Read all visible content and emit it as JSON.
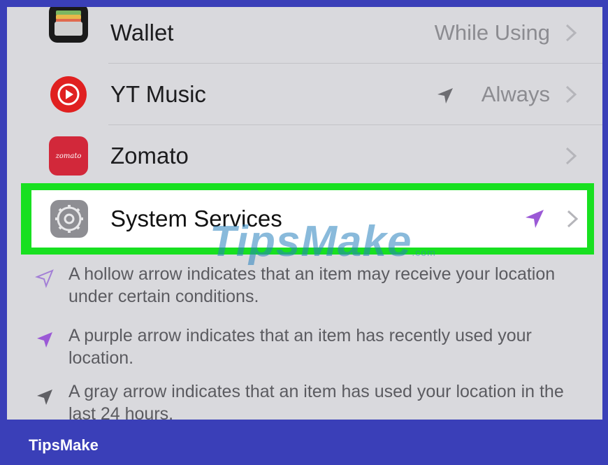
{
  "apps": [
    {
      "name": "Wallet",
      "value": "While Using",
      "icon": "wallet-icon"
    },
    {
      "name": "YT Music",
      "value": "Always",
      "icon": "yt-music-icon",
      "status_icon": "location-arrow-gray-icon"
    },
    {
      "name": "Zomato",
      "value": "",
      "icon": "zomato-icon",
      "icon_text": "zomato"
    }
  ],
  "highlighted": {
    "name": "System Services",
    "icon": "settings-gear-icon",
    "status_icon": "location-arrow-purple-icon",
    "frame_color": "#18e020"
  },
  "legend": [
    {
      "icon": "hollow-arrow-icon",
      "text": "A hollow arrow indicates that an item may receive your location under certain conditions."
    },
    {
      "icon": "purple-arrow-icon",
      "text": "A purple arrow indicates that an item has recently used your location."
    },
    {
      "icon": "gray-arrow-icon",
      "text": "A gray arrow indicates that an item has used your location in the last 24 hours."
    }
  ],
  "watermark": {
    "main": "TipsMake",
    "suffix": ".com"
  },
  "brand": "TipsMake",
  "colors": {
    "accent_purple": "#9b59d6",
    "frame_green": "#18e020",
    "background_blue": "#3a3fb8"
  }
}
